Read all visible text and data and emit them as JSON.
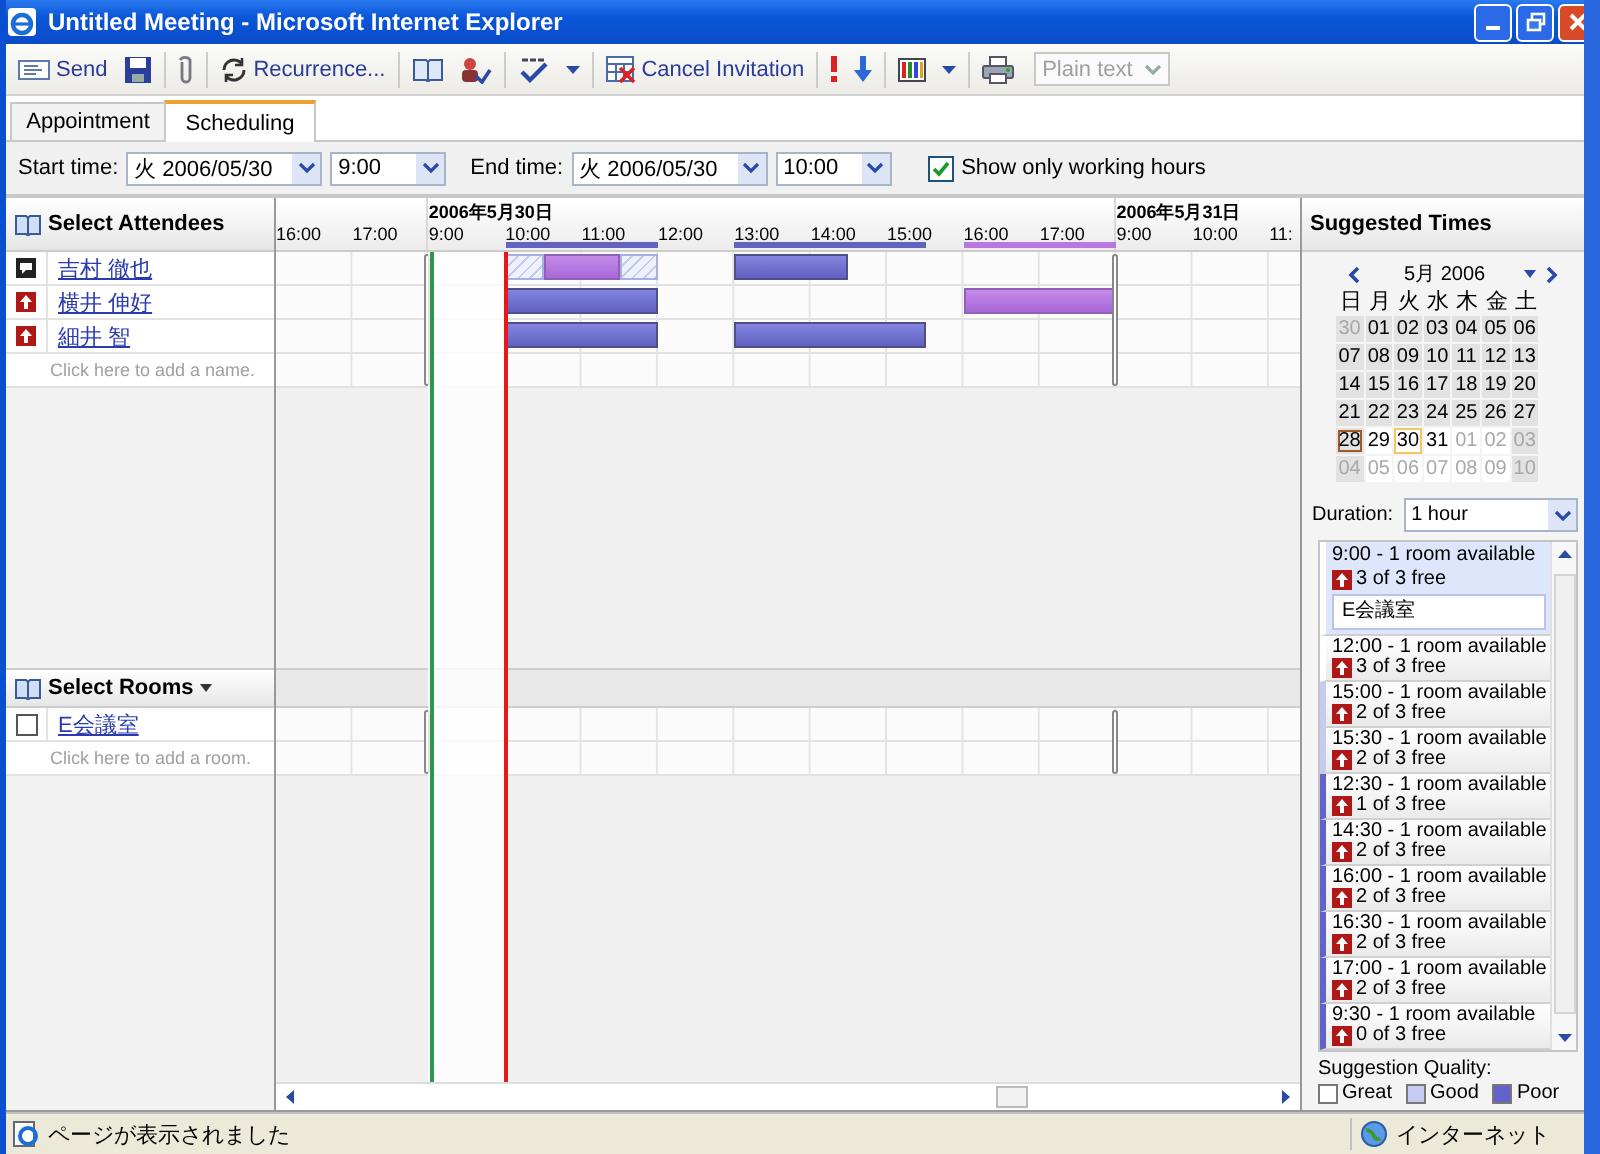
{
  "window": {
    "title": "Untitled Meeting - Microsoft Internet Explorer"
  },
  "toolbar": {
    "send": "Send",
    "recurrence": "Recurrence...",
    "cancel_invitation": "Cancel Invitation",
    "format": {
      "value": "Plain text",
      "disabled": true
    }
  },
  "tabs": [
    {
      "label": "Appointment",
      "selected": false
    },
    {
      "label": "Scheduling",
      "selected": true
    }
  ],
  "times": {
    "start_label": "Start time:",
    "start_date": "火 2006/05/30",
    "start_time": "9:00",
    "end_label": "End time:",
    "end_date": "火 2006/05/30",
    "end_time": "10:00",
    "working_hours": {
      "label": "Show only working hours",
      "checked": true
    }
  },
  "attendees": {
    "title": "Select Attendees",
    "placeholder": "Click here to add a name.",
    "people": [
      {
        "name": "吉村 徹也",
        "kind": "organizer"
      },
      {
        "name": "横井 伸好",
        "kind": "required"
      },
      {
        "name": "細井 智",
        "kind": "required"
      }
    ]
  },
  "rooms": {
    "title": "Select Rooms",
    "placeholder": "Click here to add a room.",
    "items": [
      {
        "name": "E会議室",
        "checked": false
      }
    ]
  },
  "timeline": {
    "days": [
      {
        "hours": [
          "16:00",
          "17:00"
        ]
      },
      {
        "date": "2006年5月30日",
        "hours": [
          "9:00",
          "10:00",
          "11:00",
          "12:00",
          "13:00",
          "14:00",
          "15:00",
          "16:00",
          "17:00"
        ],
        "free_busy": [
          {
            "slots": [
              {
                "kind": "free"
              },
              {
                "kind": "free"
              },
              {
                "kind": "unknown"
              },
              {
                "kind": "tentative"
              },
              {
                "kind": "tentative"
              },
              {
                "kind": "unknown"
              },
              {
                "kind": "free"
              },
              {
                "kind": "free"
              },
              {
                "kind": "busy"
              },
              {
                "kind": "busy"
              },
              {
                "kind": "busy"
              },
              {
                "kind": "free"
              },
              {
                "kind": "free"
              },
              {
                "kind": "free"
              },
              {
                "kind": "free"
              },
              {
                "kind": "free"
              },
              {
                "kind": "free"
              },
              {
                "kind": "free"
              }
            ]
          },
          {
            "slots": [
              {
                "kind": "free"
              },
              {
                "kind": "free"
              },
              {
                "kind": "busy"
              },
              {
                "kind": "busy"
              },
              {
                "kind": "busy"
              },
              {
                "kind": "busy"
              },
              {
                "kind": "free"
              },
              {
                "kind": "free"
              },
              {
                "kind": "free"
              },
              {
                "kind": "free"
              },
              {
                "kind": "free"
              },
              {
                "kind": "free"
              },
              {
                "kind": "free"
              },
              {
                "kind": "free"
              },
              {
                "kind": "tentative"
              },
              {
                "kind": "tentative"
              },
              {
                "kind": "tentative"
              },
              {
                "kind": "tentative"
              }
            ]
          },
          {
            "slots": [
              {
                "kind": "free"
              },
              {
                "kind": "free"
              },
              {
                "kind": "busy"
              },
              {
                "kind": "busy"
              },
              {
                "kind": "busy"
              },
              {
                "kind": "busy"
              },
              {
                "kind": "free"
              },
              {
                "kind": "free"
              },
              {
                "kind": "busy"
              },
              {
                "kind": "busy"
              },
              {
                "kind": "busy"
              },
              {
                "kind": "busy"
              },
              {
                "kind": "busy"
              },
              {
                "kind": "free"
              },
              {
                "kind": "free"
              },
              {
                "kind": "free"
              },
              {
                "kind": "free"
              },
              {
                "kind": "free"
              }
            ]
          }
        ]
      },
      {
        "date": "2006年5月31日",
        "hours": [
          "9:00",
          "10:00",
          "11:"
        ]
      }
    ]
  },
  "suggested": {
    "title": "Suggested Times",
    "calendar": {
      "month": "5月 2006",
      "weekdays": [
        "日",
        "月",
        "火",
        "水",
        "木",
        "金",
        "土"
      ],
      "weeks": [
        [
          {
            "d": "30",
            "today": false,
            "selected": false
          },
          {
            "d": "01",
            "today": false,
            "selected": false
          },
          {
            "d": "02",
            "today": false,
            "selected": false
          },
          {
            "d": "03",
            "today": false,
            "selected": false
          },
          {
            "d": "04",
            "today": false,
            "selected": false
          },
          {
            "d": "05",
            "today": false,
            "selected": false
          },
          {
            "d": "06",
            "today": false,
            "selected": false
          }
        ],
        [
          {
            "d": "07",
            "today": false,
            "selected": false
          },
          {
            "d": "08",
            "today": false,
            "selected": false
          },
          {
            "d": "09",
            "today": false,
            "selected": false
          },
          {
            "d": "10",
            "today": false,
            "selected": false
          },
          {
            "d": "11",
            "today": false,
            "selected": false
          },
          {
            "d": "12",
            "today": false,
            "selected": false
          },
          {
            "d": "13",
            "today": false,
            "selected": false
          }
        ],
        [
          {
            "d": "14",
            "today": false,
            "selected": false
          },
          {
            "d": "15",
            "today": false,
            "selected": false
          },
          {
            "d": "16",
            "today": false,
            "selected": false
          },
          {
            "d": "17",
            "today": false,
            "selected": false
          },
          {
            "d": "18",
            "today": false,
            "selected": false
          },
          {
            "d": "19",
            "today": false,
            "selected": false
          },
          {
            "d": "20",
            "today": false,
            "selected": false
          }
        ],
        [
          {
            "d": "21",
            "today": false,
            "selected": false
          },
          {
            "d": "22",
            "today": false,
            "selected": false
          },
          {
            "d": "23",
            "today": false,
            "selected": false
          },
          {
            "d": "24",
            "today": false,
            "selected": false
          },
          {
            "d": "25",
            "today": false,
            "selected": false
          },
          {
            "d": "26",
            "today": false,
            "selected": false
          },
          {
            "d": "27",
            "today": false,
            "selected": false
          }
        ],
        [
          {
            "d": "28",
            "today": true,
            "selected": false
          },
          {
            "d": "29",
            "today": false,
            "selected": false
          },
          {
            "d": "30",
            "today": false,
            "selected": true
          },
          {
            "d": "31",
            "today": false,
            "selected": false
          },
          {
            "d": "01",
            "today": false,
            "selected": false
          },
          {
            "d": "02",
            "today": false,
            "selected": false
          },
          {
            "d": "03",
            "today": false,
            "selected": false
          }
        ],
        [
          {
            "d": "04",
            "today": false,
            "selected": false
          },
          {
            "d": "05",
            "today": false,
            "selected": false
          },
          {
            "d": "06",
            "today": false,
            "selected": false
          },
          {
            "d": "07",
            "today": false,
            "selected": false
          },
          {
            "d": "08",
            "today": false,
            "selected": false
          },
          {
            "d": "09",
            "today": false,
            "selected": false
          },
          {
            "d": "10",
            "today": false,
            "selected": false
          }
        ]
      ]
    },
    "duration": {
      "label": "Duration:",
      "value": "1 hour"
    },
    "items": [
      {
        "time": "9:00 - 1 room available",
        "free": "3 of 3 free",
        "kind": "great",
        "selected": true,
        "room": "E会議室"
      },
      {
        "time": "12:00 - 1 room available",
        "free": "3 of 3 free",
        "kind": "great",
        "selected": false
      },
      {
        "time": "15:00 - 1 room available",
        "free": "2 of 3 free",
        "kind": "good",
        "selected": false
      },
      {
        "time": "15:30 - 1 room available",
        "free": "2 of 3 free",
        "kind": "good",
        "selected": false
      },
      {
        "time": "12:30 - 1 room available",
        "free": "1 of 3 free",
        "kind": "poor",
        "selected": false
      },
      {
        "time": "14:30 - 1 room available",
        "free": "2 of 3 free",
        "kind": "poor",
        "selected": false
      },
      {
        "time": "16:00 - 1 room available",
        "free": "2 of 3 free",
        "kind": "poor",
        "selected": false
      },
      {
        "time": "16:30 - 1 room available",
        "free": "2 of 3 free",
        "kind": "poor",
        "selected": false
      },
      {
        "time": "17:00 - 1 room available",
        "free": "2 of 3 free",
        "kind": "poor",
        "selected": false
      },
      {
        "time": "9:30 - 1 room available",
        "free": "0 of 3 free",
        "kind": "poor",
        "selected": false
      }
    ],
    "legend": {
      "title": "Suggestion Quality:",
      "items": [
        {
          "label": "Great",
          "kind": "great"
        },
        {
          "label": "Good",
          "kind": "good"
        },
        {
          "label": "Poor",
          "kind": "poor"
        }
      ]
    }
  },
  "status_bar": {
    "text": "ページが表示されました",
    "zone": "インターネット"
  }
}
